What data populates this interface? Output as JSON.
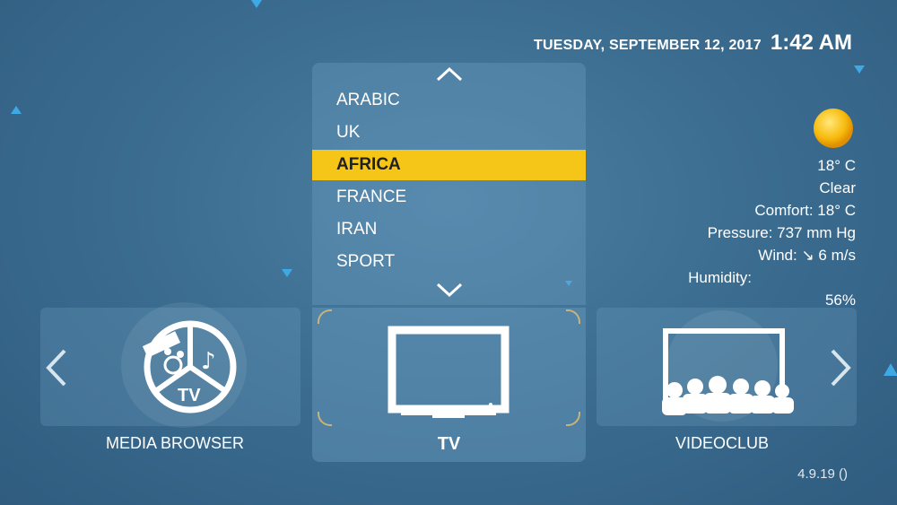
{
  "header": {
    "date": "TUESDAY, SEPTEMBER 12, 2017",
    "time": "1:42 AM"
  },
  "category_menu": {
    "items": [
      {
        "label": "ARABIC",
        "selected": false
      },
      {
        "label": "UK",
        "selected": false
      },
      {
        "label": "AFRICA",
        "selected": true
      },
      {
        "label": "FRANCE",
        "selected": false
      },
      {
        "label": "IRAN",
        "selected": false
      },
      {
        "label": "SPORT",
        "selected": false
      }
    ],
    "highlight_color": "#f5c518"
  },
  "tiles": [
    {
      "label": "MEDIA BROWSER",
      "icon": "media-browser-tv-icon"
    },
    {
      "label": "TV",
      "icon": "tv-monitor-icon",
      "selected": true
    },
    {
      "label": "VIDEOCLUB",
      "icon": "cinema-audience-icon"
    }
  ],
  "weather": {
    "icon": "sun-icon",
    "temperature": "18° C",
    "condition": "Clear",
    "comfort": "Comfort: 18° C",
    "pressure": "Pressure: 737 mm Hg",
    "wind": "Wind: ↘ 6 m/s",
    "humidity_label": "Humidity:",
    "humidity_value": "56%"
  },
  "version": "4.9.19 ()",
  "colors": {
    "background": "#3c6e92",
    "accent": "#f5c518",
    "sparkle": "#3fa9e6"
  }
}
